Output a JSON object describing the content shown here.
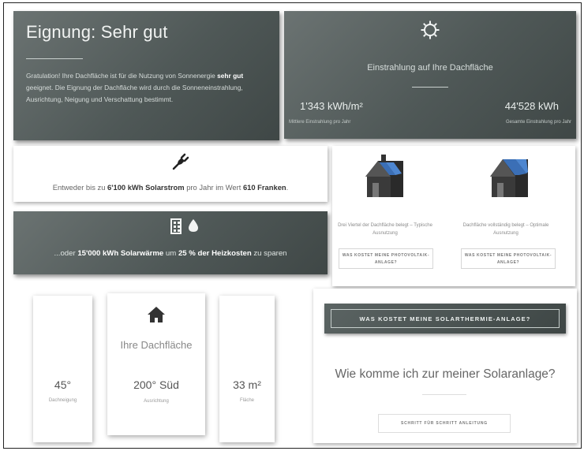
{
  "eignung": {
    "title": "Eignung: Sehr gut",
    "text_start": "Gratulation! Ihre Dachfläche ist für die Nutzung von Sonnenergie",
    "text_bold": "sehr gut",
    "text_end": "geeignet. Die Eignung der Dachfläche wird durch die Sonneneinstrahlung, Ausrichtung, Neigung und Verschattung bestimmt."
  },
  "einstrahlung": {
    "icon": "sun-icon",
    "title": "Einstrahlung auf Ihre Dachfläche",
    "left_value": "1'343 kWh/m²",
    "left_caption": "Mittlere Einstrahlung pro Jahr",
    "right_value": "44'528 kWh",
    "right_caption": "Gesamte Einstrahlung pro Jahr"
  },
  "strom": {
    "icon": "plug-icon",
    "pre": "Entweder bis zu ",
    "amount": "6'100 kWh Solarstrom",
    "mid": " pro Jahr im Wert ",
    "value": "610 Franken",
    "post": "."
  },
  "waerme": {
    "icons": [
      "solar-panel-icon",
      "water-drop-icon"
    ],
    "pre": "...oder ",
    "amount": "15'000 kWh Solarwärme",
    "mid": " um ",
    "percent": "25 % der Heizkosten",
    "post": " zu sparen"
  },
  "anlagen": {
    "left_caption": "Drei Viertel der Dachfläche belegt – Typische Ausnutzung",
    "left_button": "WAS KOSTET MEINE PHOTOVOLTAIK-ANLAGE?",
    "right_caption": "Dachfläche vollständig belegt – Optimale Ausnutzung",
    "right_button": "WAS KOSTET MEINE PHOTOVOLTAIK-ANLAGE?"
  },
  "dach": {
    "title": "Ihre Dachfläche",
    "neigung_value": "45°",
    "neigung_caption": "Dachneigung",
    "ausrichtung_value": "200° Süd",
    "ausrichtung_caption": "Ausrichtung",
    "flaeche_value": "33 m²",
    "flaeche_caption": "Fläche"
  },
  "guide": {
    "thermie_button": "WAS KOSTET MEINE SOLARTHERMIE-ANLAGE?",
    "question": "Wie komme ich zur meiner Solaranlage?",
    "anleitung_button": "SCHRITT FÜR SCHRITT ANLEITUNG"
  }
}
